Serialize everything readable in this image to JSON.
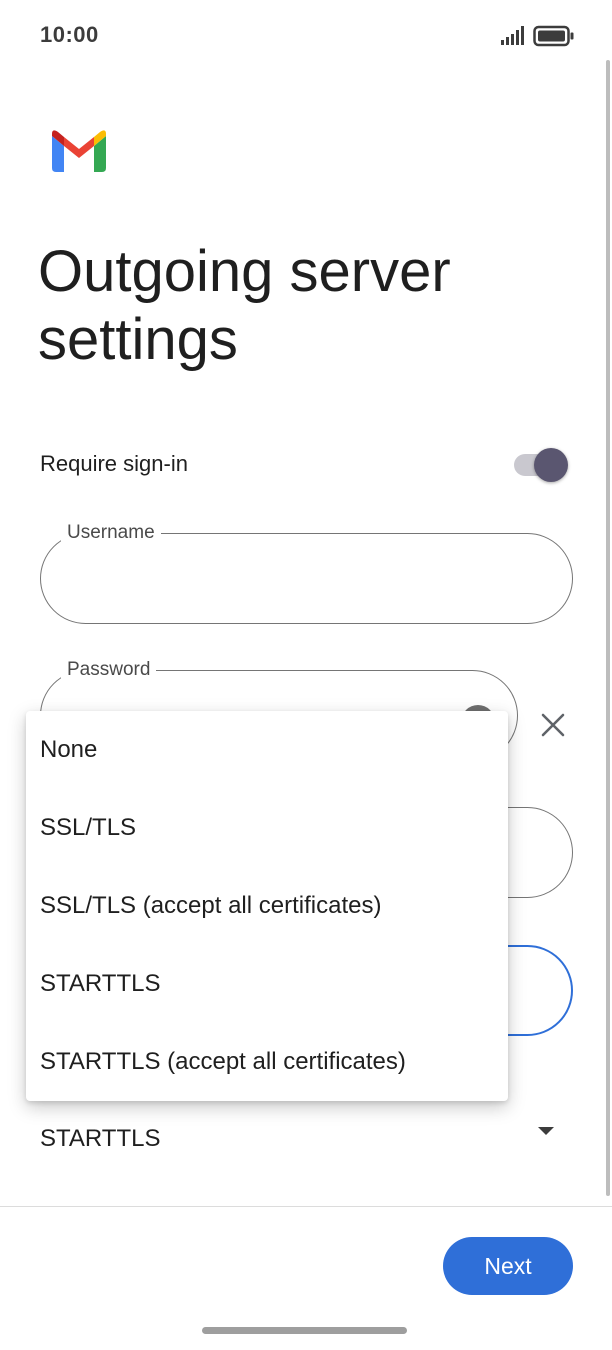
{
  "status_bar": {
    "time": "10:00"
  },
  "header": {
    "title": "Outgoing server settings"
  },
  "require_signin": {
    "label": "Require sign-in",
    "enabled": true
  },
  "fields": {
    "username": {
      "label": "Username",
      "value": ""
    },
    "password": {
      "label": "Password",
      "value": ""
    },
    "server": {
      "value": ""
    },
    "port": {
      "value": "",
      "focused": true
    }
  },
  "security": {
    "selected": "STARTTLS",
    "options": [
      "None",
      "SSL/TLS",
      "SSL/TLS (accept all certificates)",
      "STARTTLS",
      "STARTTLS (accept all certificates)"
    ]
  },
  "footer": {
    "next_label": "Next"
  },
  "colors": {
    "accent": "#2f6fd8",
    "toggle_thumb": "#5a5670",
    "toggle_track": "#c9c8cf"
  },
  "icons": {
    "logo": "gmail-logo",
    "signal": "signal-icon",
    "battery": "battery-icon",
    "visibility": "visibility-icon",
    "clear": "close-icon",
    "dropdown": "dropdown-arrow-icon"
  }
}
